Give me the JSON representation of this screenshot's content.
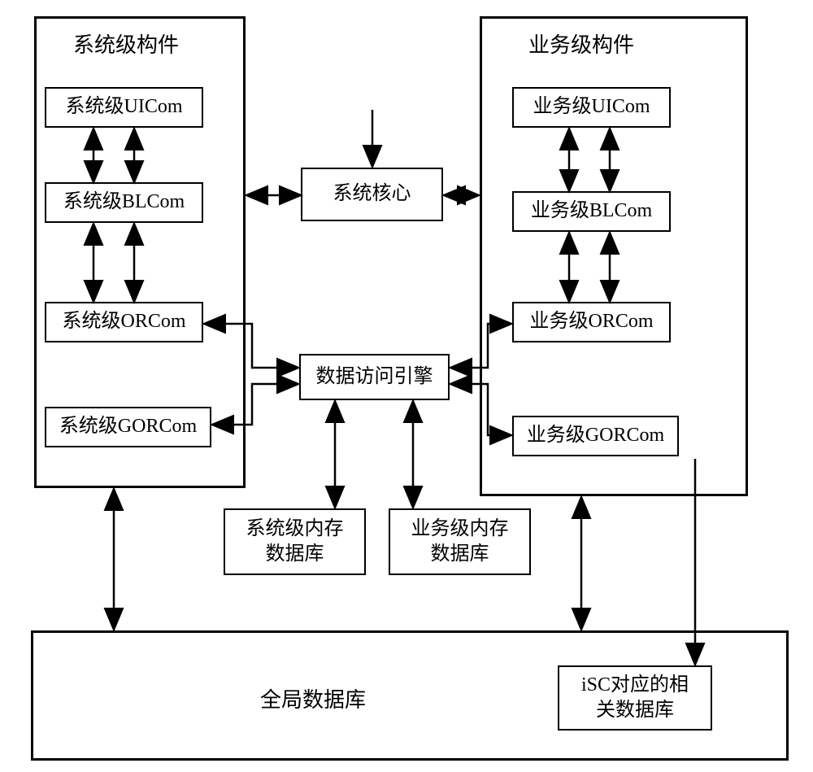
{
  "left_container_title": "系统级构件",
  "right_container_title": "业务级构件",
  "boxes": {
    "sys_uicom": "系统级UICom",
    "sys_blcom": "系统级BLCom",
    "sys_orcom": "系统级ORCom",
    "sys_gorcom": "系统级GORCom",
    "biz_uicom": "业务级UICom",
    "biz_blcom": "业务级BLCom",
    "biz_orcom": "业务级ORCom",
    "biz_gorcom": "业务级GORCom",
    "system_core": "系统核心",
    "data_access_engine": "数据访问引擎",
    "sys_mem_db": "系统级内存\n数据库",
    "biz_mem_db": "业务级内存\n数据库",
    "global_db": "全局数据库",
    "isc_db": "iSC对应的相\n关数据库"
  }
}
